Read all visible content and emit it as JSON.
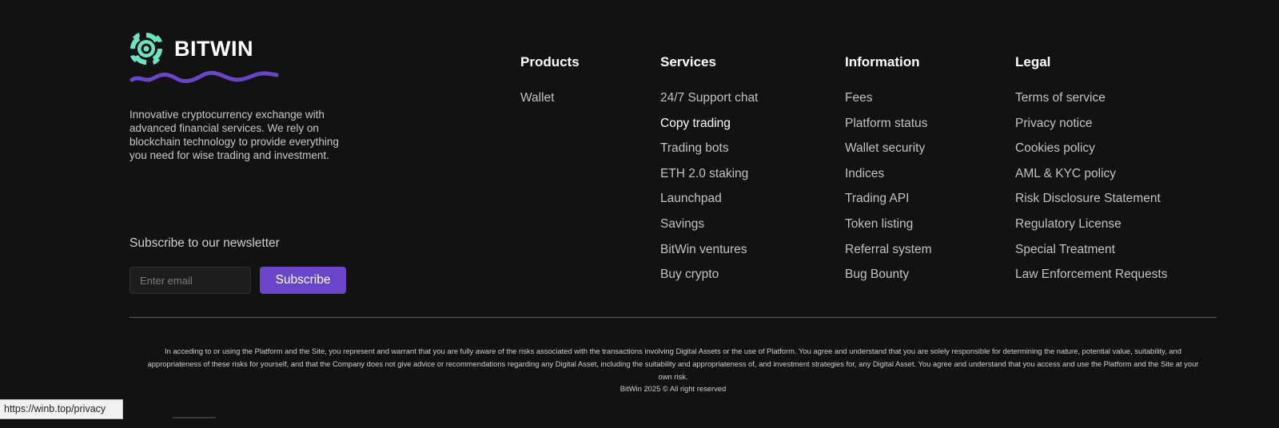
{
  "brand": {
    "name": "BITWIN",
    "description": "Innovative cryptocurrency exchange with advanced financial services. We rely on blockchain technology to provide everything you need for wise trading and investment.",
    "logo_color": "#6fe3c1",
    "squiggle_color": "#6a45c9"
  },
  "newsletter": {
    "title": "Subscribe to our newsletter",
    "email_placeholder": "Enter email",
    "email_value": "",
    "subscribe_label": "Subscribe"
  },
  "columns": [
    {
      "title": "Products",
      "links": [
        "Wallet"
      ]
    },
    {
      "title": "Services",
      "links": [
        "24/7 Support chat",
        "Copy trading",
        "Trading bots",
        "ETH 2.0 staking",
        "Launchpad",
        "Savings",
        "BitWin ventures",
        "Buy crypto"
      ]
    },
    {
      "title": "Information",
      "links": [
        "Fees",
        "Platform status",
        "Wallet security",
        "Indices",
        "Trading API",
        "Token listing",
        "Referral system",
        "Bug Bounty"
      ]
    },
    {
      "title": "Legal",
      "links": [
        "Terms of service",
        "Privacy notice",
        "Cookies policy",
        "AML & KYC policy",
        "Risk Disclosure Statement",
        "Regulatory License",
        "Special Treatment",
        "Law Enforcement Requests"
      ]
    }
  ],
  "footer": {
    "disclaimer": "In acceding to or using the Platform and the Site, you represent and warrant that you are fully aware of the risks associated with the transactions involving Digital Assets or the use of Platform. You agree and understand that you are solely responsible for determining the nature, potential value, suitability, and appropriateness of these risks for yourself, and that the Company does not give advice or recommendations regarding any Digital Asset, including the suitability and appropriateness of, and investment strategies for, any Digital Asset. You agree and understand that you access and use the Platform and the Site at your own risk.",
    "copyright": "BitWin 2025 © All right reserved"
  },
  "status_bar": {
    "url": "https://winb.top/privacy"
  },
  "colors": {
    "background": "#121212",
    "accent": "#6a45c9",
    "text": "#c2c2c2",
    "heading": "#ffffff"
  }
}
